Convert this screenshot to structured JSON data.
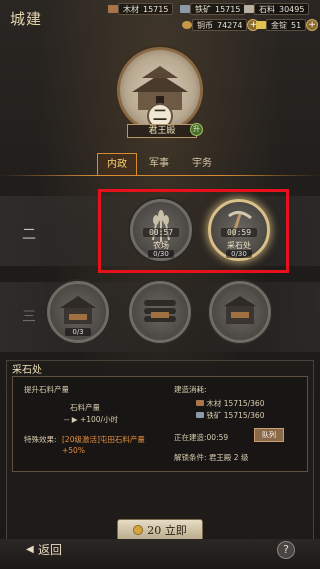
{
  "header": {
    "title": "城建",
    "resources": [
      {
        "label": "木材",
        "value": "15715",
        "color": "#a8744a",
        "icon": "wood-icon"
      },
      {
        "label": "铁矿",
        "value": "15715",
        "color": "#8a9aa8",
        "icon": "iron-icon"
      },
      {
        "label": "石料",
        "value": "30495",
        "color": "#b8b0a0",
        "icon": "stone-icon"
      },
      {
        "label": "铜币",
        "value": "74274",
        "color": "#c89848",
        "icon": "copper-coin-icon"
      },
      {
        "label": "金锭",
        "value": "51",
        "color": "#e0c050",
        "icon": "gold-ingot-icon"
      }
    ]
  },
  "main_building": {
    "level": "二",
    "name": "君王殿",
    "upgrade": "升"
  },
  "tabs": [
    "内政",
    "军事",
    "宇务"
  ],
  "rows": [
    {
      "label": "二"
    },
    {
      "label": "三"
    }
  ],
  "buildings_row2": [
    {
      "name": "农场",
      "timer": "00:57",
      "count": "0/30",
      "icon": "wheat-icon"
    },
    {
      "name": "采石处",
      "timer": "00:59",
      "count": "0/30",
      "icon": "pickaxe-icon"
    }
  ],
  "buildings_row3": [
    {
      "count": "0/3",
      "icon": "locked-building-icon"
    },
    {
      "count": "",
      "icon": "locked-lumber-icon"
    },
    {
      "count": "",
      "icon": "locked-mine-icon"
    }
  ],
  "panel": {
    "title": "采石处",
    "desc": "提升石料产量",
    "yield_label": "石料产量",
    "yield_value": "-- ▶ +100/小时",
    "special_label": "特殊效果:",
    "special_value": "[20级激活]屯田石料产量+50%",
    "cost_label": "建造消耗:",
    "costs": [
      "木材 15715/360",
      "铁矿 15715/360"
    ],
    "building_now": "正在建造:00:59",
    "queue_btn": "队列",
    "unlock": "解锁条件: 君王殿 2 级",
    "instant": "20 立即"
  },
  "footer": {
    "back": "返回",
    "help": "?"
  }
}
